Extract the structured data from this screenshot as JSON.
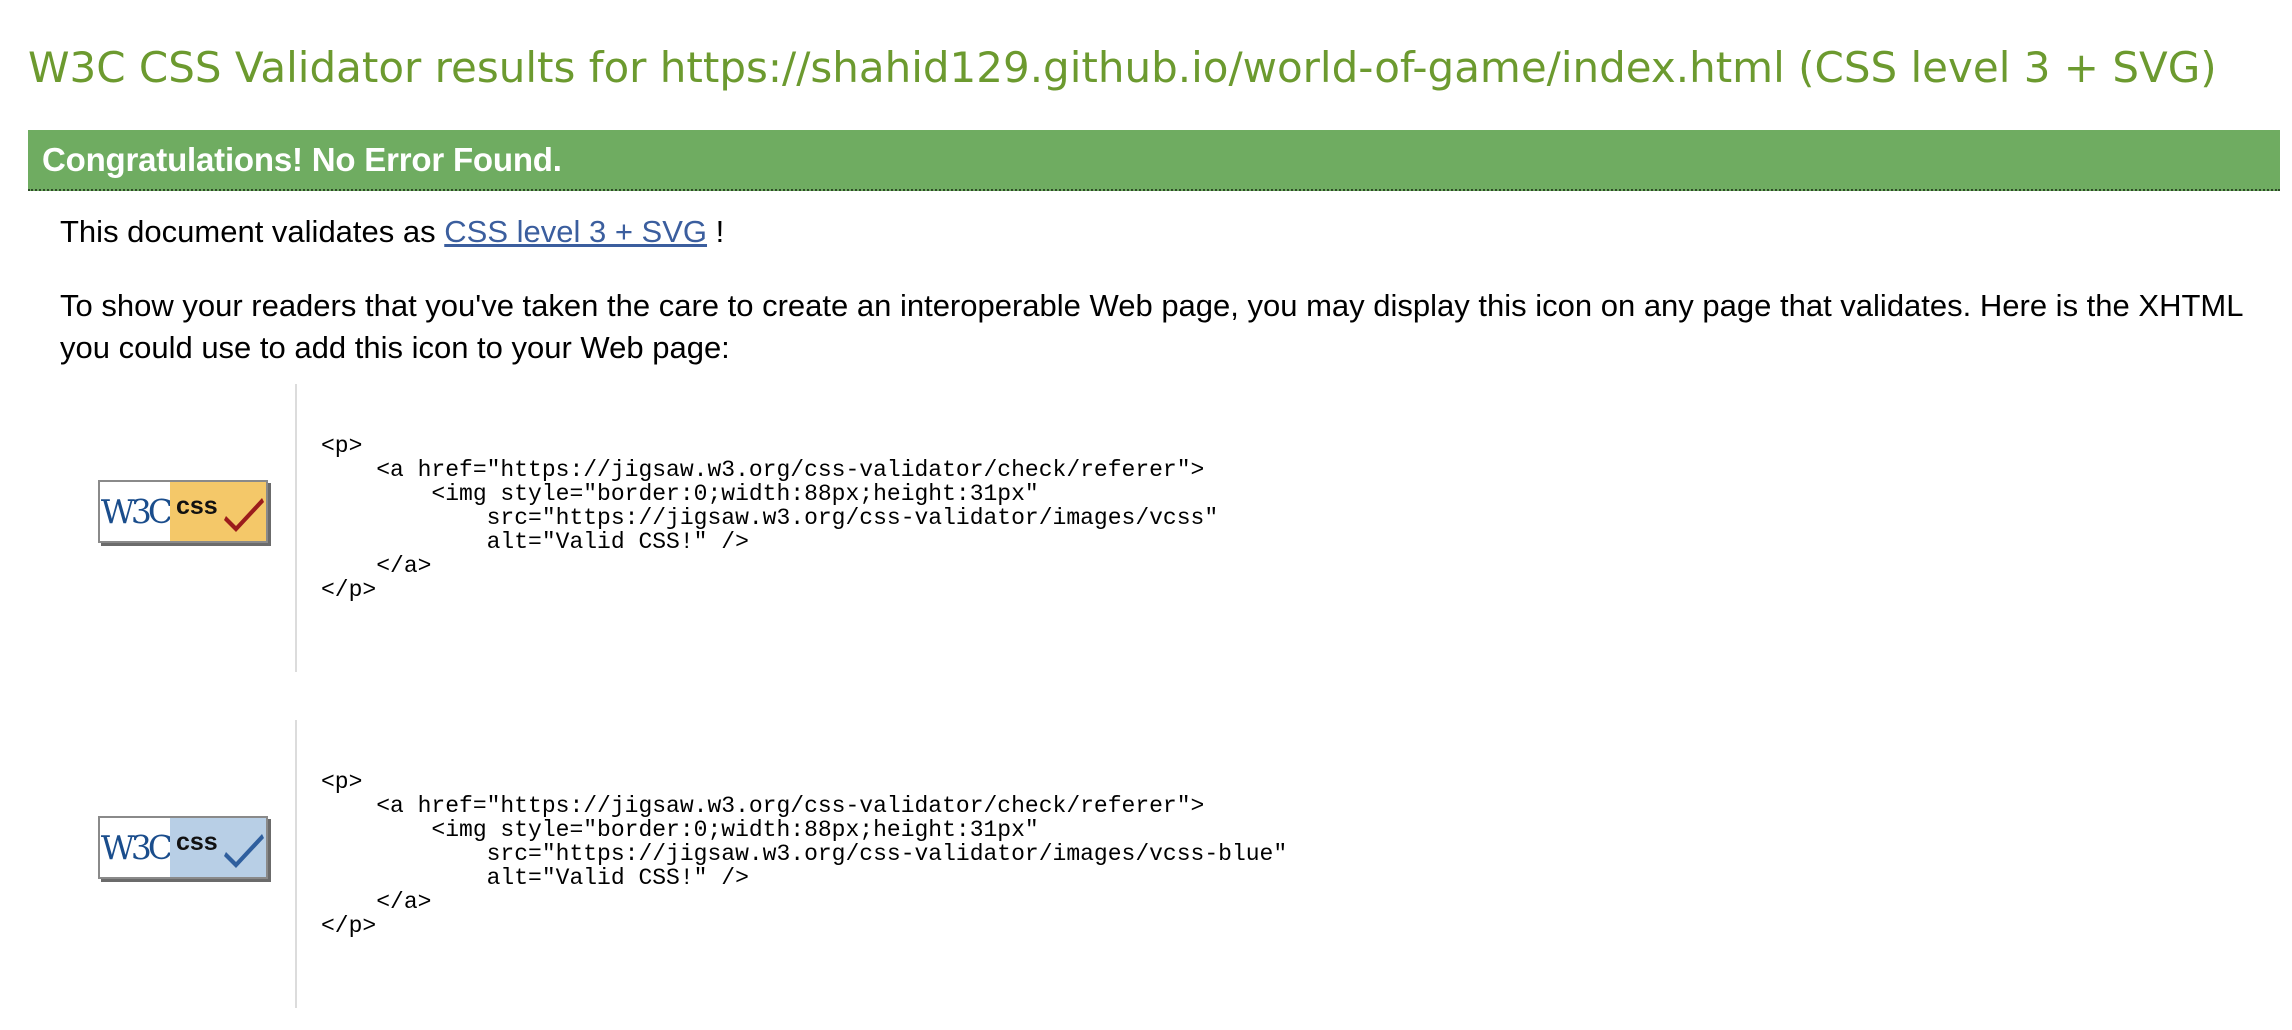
{
  "page": {
    "title": "W3C CSS Validator results for https://shahid129.github.io/world-of-game/index.html (CSS level 3 + SVG)"
  },
  "banner": {
    "text": "Congratulations! No Error Found."
  },
  "intro": {
    "prefix": "This document validates as ",
    "link_text": "CSS level 3 + SVG",
    "suffix": " !"
  },
  "readers_note": "To show your readers that you've taken the care to create an interoperable Web page, you may display this icon on any page that validates. Here is the XHTML you could use to add this icon to your Web page:",
  "badges": [
    {
      "w3c_text": "W3C",
      "css_text": "css",
      "badge_color": "#f4c869",
      "check_color": "#9b1c1c",
      "code": "<p>\n    <a href=\"https://jigsaw.w3.org/css-validator/check/referer\">\n        <img style=\"border:0;width:88px;height:31px\"\n            src=\"https://jigsaw.w3.org/css-validator/images/vcss\"\n            alt=\"Valid CSS!\" />\n    </a>\n</p>"
    },
    {
      "w3c_text": "W3C",
      "css_text": "css",
      "badge_color": "#b8cfe6",
      "check_color": "#2f5f9e",
      "code": "<p>\n    <a href=\"https://jigsaw.w3.org/css-validator/check/referer\">\n        <img style=\"border:0;width:88px;height:31px\"\n            src=\"https://jigsaw.w3.org/css-validator/images/vcss-blue\"\n            alt=\"Valid CSS!\" />\n    </a>\n</p>"
    }
  ],
  "colors": {
    "title": "#6c9a2f",
    "banner_bg": "#6fac61",
    "link": "#3b5e9e"
  },
  "icons": [
    "w3c-css-valid-gold-icon",
    "w3c-css-valid-blue-icon",
    "checkmark-icon"
  ]
}
